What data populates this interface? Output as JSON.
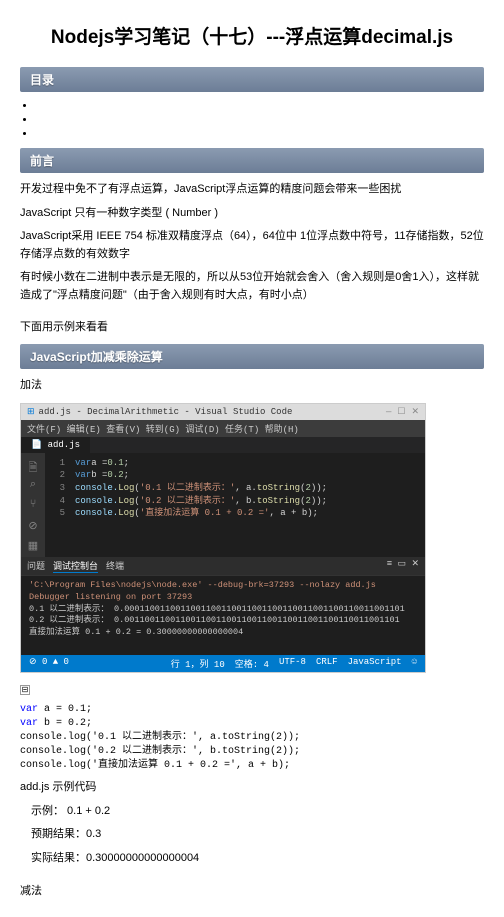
{
  "title": "Nodejs学习笔记（十七）---浮点运算decimal.js",
  "sections": {
    "toc": "目录",
    "preface": "前言",
    "jsop": "JavaScript加减乘除运算"
  },
  "preface": {
    "p1": "开发过程中免不了有浮点运算，JavaScript浮点运算的精度问题会带来一些困扰",
    "p2": "JavaScript 只有一种数字类型 ( Number )",
    "p3": "JavaScript采用 IEEE 754 标准双精度浮点（64），64位中 1位浮点数中符号，11存储指数，52位存储浮点数的有效数字",
    "p4": "有时候小数在二进制中表示是无限的，所以从53位开始就会舍入（舍入规则是0舍1入），这样就造成了\"浮点精度问题\"（由于舍入规则有时大点，有时小点）",
    "p5": "下面用示例来看看"
  },
  "subh": {
    "add": "加法",
    "sub": "减法"
  },
  "editor": {
    "title": "add.js - DecimalArithmetic - Visual Studio Code",
    "menu": "文件(F)  编辑(E)  查看(V)  转到(G)  调试(D)  任务(T)  帮助(H)",
    "tab": "add.js",
    "lines": {
      "l1a": "var",
      "l1b": " a = ",
      "l1c": "0.1",
      "l1d": ";",
      "l2a": "var",
      "l2b": " b = ",
      "l2c": "0.2",
      "l2d": ";",
      "l3a": "console.",
      "l3b": "Log",
      "l3c": "(",
      "l3d": "'0.1 以二进制表示：'",
      "l3e": ", a.",
      "l3f": "toString",
      "l3g": "(",
      "l3h": "2",
      "l3i": "));",
      "l4a": "console.",
      "l4b": "Log",
      "l4c": "(",
      "l4d": "'0.2 以二进制表示：'",
      "l4e": ", b.",
      "l4f": "toString",
      "l4g": "(",
      "l4h": "2",
      "l4i": "));",
      "l5a": "console.",
      "l5b": "Log",
      "l5c": "(",
      "l5d": "'直接加法运算 0.1 + 0.2 ='",
      "l5e": ", a + b);"
    },
    "debug": {
      "tab1": "问题",
      "tab2": "调试控制台",
      "tab3": "终端"
    },
    "term": {
      "l1": "'C:\\Program Files\\nodejs\\node.exe' --debug-brk=37293 --nolazy add.js",
      "l2": "Debugger listening on port 37293",
      "l3": "0.1 以二进制表示： 0.0001100110011001100110011001100110011001100110011001101",
      "l4": "0.2 以二进制表示： 0.001100110011001100110011001100110011001100110011001101",
      "l5": "直接加法运算 0.1 + 0.2 = 0.30000000000000004"
    },
    "status": {
      "left": "⊘ 0 ▲ 0",
      "ln": "行 1，列 10",
      "sp": "空格: 4",
      "enc": "UTF-8",
      "eol": "CRLF",
      "lang": "JavaScript",
      "face": "☺"
    }
  },
  "code": {
    "l1a": "var",
    "l1b": " a = 0.1;",
    "l2a": "var",
    "l2b": " b = 0.2;",
    "l3": "console.log('0.1 以二进制表示：', a.toString(2));",
    "l4": "console.log('0.2 以二进制表示：', b.toString(2));",
    "l5": "console.log('直接加法运算 0.1 + 0.2 =', a + b);"
  },
  "notes": {
    "caption": "add.js 示例代码",
    "ex": "　示例：  0.1 + 0.2",
    "expect": "　预期结果：0.3",
    "actual": "　实际结果：0.30000000000000004"
  }
}
